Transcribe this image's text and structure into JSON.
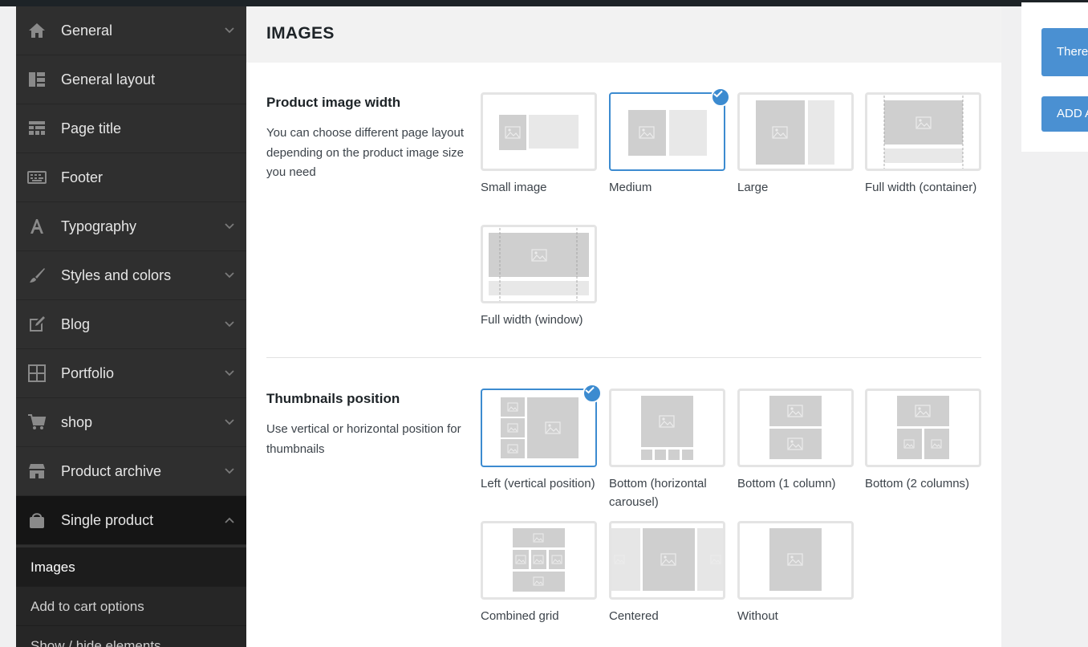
{
  "sidebar": {
    "items": [
      {
        "label": "General",
        "icon": "home-icon"
      },
      {
        "label": "General layout",
        "icon": "layout-icon"
      },
      {
        "label": "Page title",
        "icon": "page-title-icon"
      },
      {
        "label": "Footer",
        "icon": "keyboard-icon"
      },
      {
        "label": "Typography",
        "icon": "typography-icon"
      },
      {
        "label": "Styles and colors",
        "icon": "brush-icon"
      },
      {
        "label": "Blog",
        "icon": "edit-icon"
      },
      {
        "label": "Portfolio",
        "icon": "grid-icon"
      },
      {
        "label": "shop",
        "icon": "cart-icon"
      },
      {
        "label": "Product archive",
        "icon": "store-icon"
      },
      {
        "label": "Single product",
        "icon": "bag-icon"
      }
    ],
    "subitems": [
      {
        "label": "Images"
      },
      {
        "label": "Add to cart options"
      },
      {
        "label": "Show / hide elements"
      }
    ]
  },
  "main": {
    "title": "IMAGES",
    "sections": [
      {
        "title": "Product image width",
        "description": "You can choose different page layout depending on the product image size you need",
        "options": [
          {
            "label": "Small image"
          },
          {
            "label": "Medium"
          },
          {
            "label": "Large"
          },
          {
            "label": "Full width (container)"
          },
          {
            "label": "Full width (window)"
          }
        ],
        "selected": "Medium"
      },
      {
        "title": "Thumbnails position",
        "description": "Use vertical or horizontal position for thumbnails",
        "options": [
          {
            "label": "Left (vertical position)"
          },
          {
            "label": "Bottom (horizontal carousel)"
          },
          {
            "label": "Bottom (1 column)"
          },
          {
            "label": "Bottom (2 columns)"
          },
          {
            "label": "Combined grid"
          },
          {
            "label": "Centered"
          },
          {
            "label": "Without"
          }
        ],
        "selected": "Left (vertical position)"
      }
    ]
  },
  "right_panel": {
    "button1": "There",
    "button2": "ADD A"
  },
  "colors": {
    "accent": "#3c8bd0",
    "sidebar_bg": "#2f2f2f",
    "sidebar_active": "#151515",
    "button_blue": "#4a90d2"
  }
}
